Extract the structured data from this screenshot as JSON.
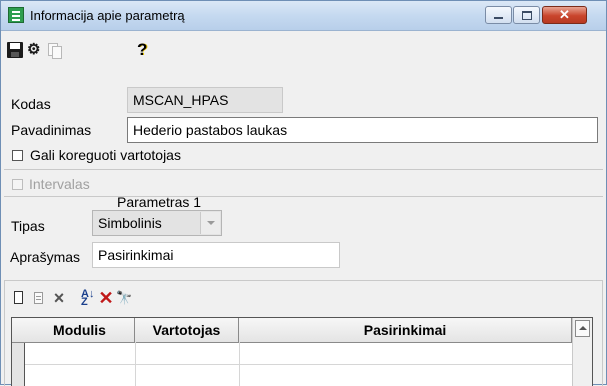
{
  "window": {
    "title": "Informacija apie parametrą",
    "close_label": "✕"
  },
  "toolbar": {
    "icons": [
      "save-icon",
      "properties-icon",
      "copy-icon",
      "help-icon"
    ]
  },
  "form": {
    "kodas_label": "Kodas",
    "kodas_value": "MSCAN_HPAS",
    "pavadinimas_label": "Pavadinimas",
    "pavadinimas_value": "Hederio pastabos laukas",
    "editable_label": "Gali koreguoti vartotojas",
    "editable_checked": false
  },
  "intervalas": {
    "label": "Intervalas",
    "checked": false,
    "enabled": false
  },
  "parametras": {
    "heading": "Parametras 1",
    "tipas_label": "Tipas",
    "tipas_value": "Simbolinis",
    "aprasymas_label": "Aprašymas",
    "aprasymas_value": "Pasirinkimai"
  },
  "grid_toolbar": {
    "icons": [
      "new-icon",
      "edit-icon",
      "delete-icon",
      "sort-icon",
      "delete-red-icon",
      "find-icon"
    ],
    "sort_glyph_top": "A",
    "sort_glyph_bottom": "Z"
  },
  "grid": {
    "columns": [
      "Modulis",
      "Vartotojas",
      "Pasirinkimai"
    ],
    "rows": []
  }
}
